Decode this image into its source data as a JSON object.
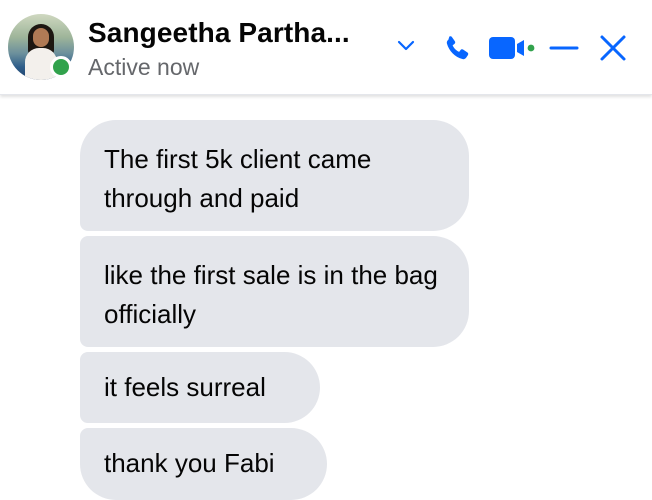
{
  "header": {
    "contact_name": "Sangeetha Partha...",
    "status": "Active now",
    "status_color": "#31a24c",
    "accent_color": "#0866ff",
    "icons": [
      "chevron-down-icon",
      "phone-icon",
      "video-call-icon",
      "minimize-icon",
      "close-icon"
    ]
  },
  "messages": [
    {
      "text": "The first 5k client came through and paid"
    },
    {
      "text": "like the first sale is in the bag officially"
    },
    {
      "text": "it feels surreal"
    },
    {
      "text": "thank you Fabi"
    }
  ],
  "bubble_color": "#e4e6eb"
}
